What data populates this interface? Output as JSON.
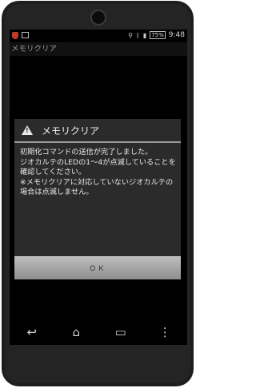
{
  "status_bar": {
    "icons_left": [
      "shield-icon",
      "image-icon"
    ],
    "icons_right": [
      "location-icon",
      "bluetooth-icon",
      "signal-icon"
    ],
    "battery": "75%",
    "time": "9:48"
  },
  "app": {
    "title": "メモリクリア"
  },
  "dialog": {
    "title": "メモリクリア",
    "message": "初期化コマンドの送信が完了しました。\nジオカルテのLEDの1～4が点滅していることを確認してください。\n※メモリクリアに対応していないジオカルテの場合は点滅しません。",
    "ok_label": "ＯＫ"
  },
  "navigation": {
    "back": "↩",
    "home": "⌂",
    "recent": "▭",
    "menu": "⋮"
  }
}
